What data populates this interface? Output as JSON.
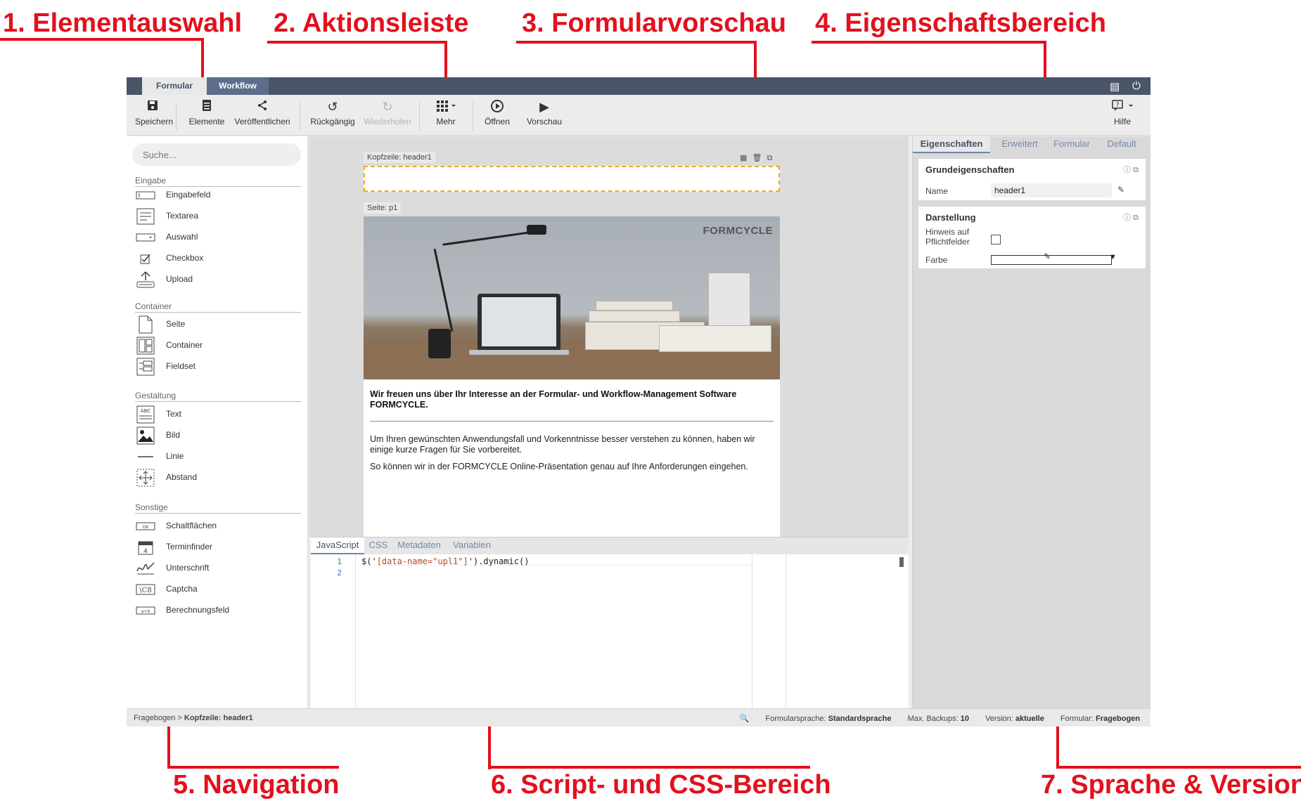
{
  "annotations": {
    "a1": "1. Elementauswahl",
    "a2": "2. Aktionsleiste",
    "a3": "3. Formularvorschau",
    "a4": "4. Eigenschaftsbereich",
    "a5": "5. Navigation",
    "a6": "6. Script- und CSS-Bereich",
    "a7": "7. Sprache & Version",
    "color": "#e3101e"
  },
  "topbar": {
    "tabs": [
      "Formular",
      "Workflow"
    ],
    "icons": [
      "chat-icon",
      "power-icon"
    ]
  },
  "toolbar": {
    "buttons": [
      {
        "label": "Speichern",
        "icon": "save-icon"
      },
      {
        "label": "Elemente",
        "icon": "list-icon"
      },
      {
        "label": "Veröffentlichen",
        "icon": "share-icon"
      },
      {
        "label": "Rückgängig",
        "icon": "undo-icon"
      },
      {
        "label": "Wiederholen",
        "icon": "redo-icon"
      },
      {
        "label": "Mehr",
        "icon": "grid-icon"
      },
      {
        "label": "Öffnen",
        "icon": "play-circle-icon"
      },
      {
        "label": "Vorschau",
        "icon": "play-icon"
      },
      {
        "label": "Hilfe",
        "icon": "help-icon"
      }
    ]
  },
  "left": {
    "search_placeholder": "Suche...",
    "categories": [
      {
        "title": "Eingabe",
        "items": [
          "Eingabefeld",
          "Textarea",
          "Auswahl",
          "Checkbox",
          "Upload"
        ]
      },
      {
        "title": "Container",
        "items": [
          "Seite",
          "Container",
          "Fieldset"
        ]
      },
      {
        "title": "Gestaltung",
        "items": [
          "Text",
          "Bild",
          "Linie",
          "Abstand"
        ]
      },
      {
        "title": "Sonstige",
        "items": [
          "Schaltflächen",
          "Terminfinder",
          "Unterschrift",
          "Captcha",
          "Berechnungsfeld"
        ]
      }
    ]
  },
  "canvas": {
    "header_label": "Kopfzeile: header1",
    "page_label": "Seite: p1",
    "logo": "FORMCYCLE",
    "bold_text": "Wir freuen uns über Ihr Interesse an der Formular- und Workflow-Management Software FORMCYCLE.",
    "para1": "Um Ihren gewünschten Anwendungsfall und Vorkenntnisse besser verstehen zu können, haben wir einige kurze Fragen für Sie vorbereitet.",
    "para2": "So können wir in der FORMCYCLE Online-Präsentation genau auf Ihre Anforderungen eingehen."
  },
  "right": {
    "tabs": [
      "Eigenschaften",
      "Erweitert",
      "Formular",
      "Default"
    ],
    "grund": {
      "title": "Grundeigenschaften",
      "name_label": "Name",
      "name_value": "header1"
    },
    "darst": {
      "title": "Darstellung",
      "hint_label": "Hinweis auf Pflichtfelder",
      "color_label": "Farbe"
    }
  },
  "code": {
    "tabs": [
      "JavaScript",
      "CSS",
      "Metadaten",
      "Variablen"
    ],
    "lines": [
      "1",
      "2"
    ],
    "code_prefix": "$('",
    "code_string": "[data-name=\"upl1\"]",
    "code_suffix": "').dynamic()"
  },
  "status": {
    "crumb_root": "Fragebogen",
    "crumb_sep": " > ",
    "crumb_current": "Kopfzeile: header1",
    "lang_label": "Formularsprache:",
    "lang_value": "Standardsprache",
    "backup_label": "Max. Backups:",
    "backup_value": "10",
    "version_label": "Version:",
    "version_value": "aktuelle",
    "form_label": "Formular:",
    "form_value": "Fragebogen"
  }
}
